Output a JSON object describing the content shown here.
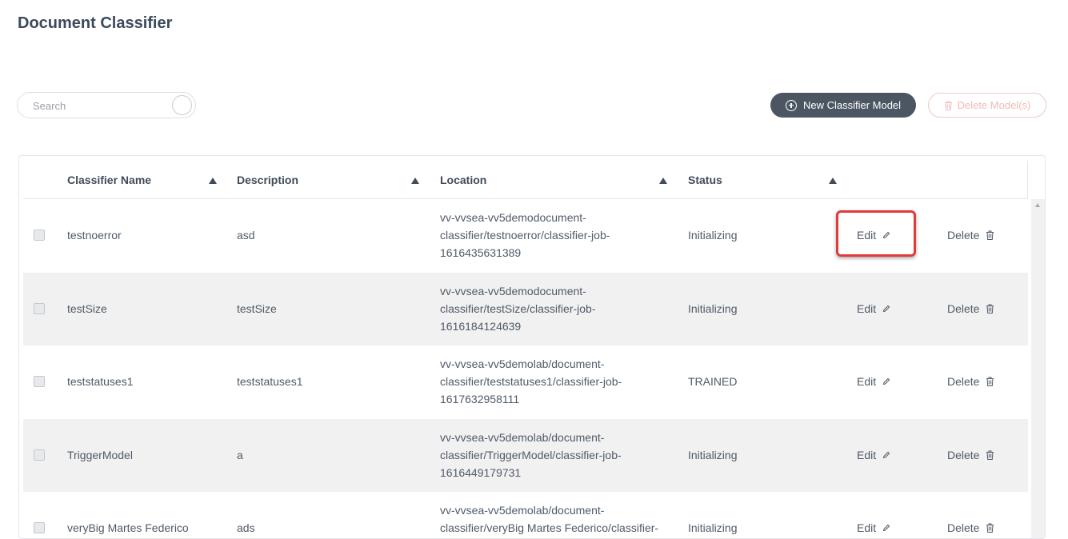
{
  "page": {
    "title": "Document Classifier"
  },
  "search": {
    "placeholder": "Search",
    "value": ""
  },
  "toolbar": {
    "new_label": "New Classifier Model",
    "delete_label": "Delete Model(s)"
  },
  "table": {
    "columns": [
      "Classifier Name",
      "Description",
      "Location",
      "Status"
    ],
    "edit_label": "Edit",
    "delete_label": "Delete",
    "rows": [
      {
        "name": "testnoerror",
        "description": "asd",
        "location": [
          "vv-vvsea-vv5demodocument-",
          "classifier/testnoerror/classifier-job-",
          "1616435631389"
        ],
        "status": "Initializing"
      },
      {
        "name": "testSize",
        "description": "testSize",
        "location": [
          "vv-vvsea-vv5demodocument-",
          "classifier/testSize/classifier-job-",
          "1616184124639"
        ],
        "status": "Initializing"
      },
      {
        "name": "teststatuses1",
        "description": "teststatuses1",
        "location": [
          "vv-vvsea-vv5demolab/document-",
          "classifier/teststatuses1/classifier-job-",
          "1617632958111"
        ],
        "status": "TRAINED"
      },
      {
        "name": "TriggerModel",
        "description": "a",
        "location": [
          "vv-vvsea-vv5demolab/document-",
          "classifier/TriggerModel/classifier-job-",
          "1616449179731"
        ],
        "status": "Initializing"
      },
      {
        "name": "veryBig Martes Federico",
        "description": "ads",
        "location": [
          "vv-vvsea-vv5demolab/document-",
          "classifier/veryBig Martes Federico/classifier-",
          ""
        ],
        "status": "Initializing"
      }
    ]
  },
  "colors": {
    "primary_button": "#4c5663",
    "danger_muted": "#f2b8b8",
    "highlight": "#e23a3a",
    "row_alt": "#f1f1f1"
  },
  "icons": {
    "new_button": "plus-circle-icon",
    "delete_button": "trash-icon",
    "edit": "pencil-icon",
    "delete": "trash-icon",
    "sort": "triangle-up-icon"
  }
}
